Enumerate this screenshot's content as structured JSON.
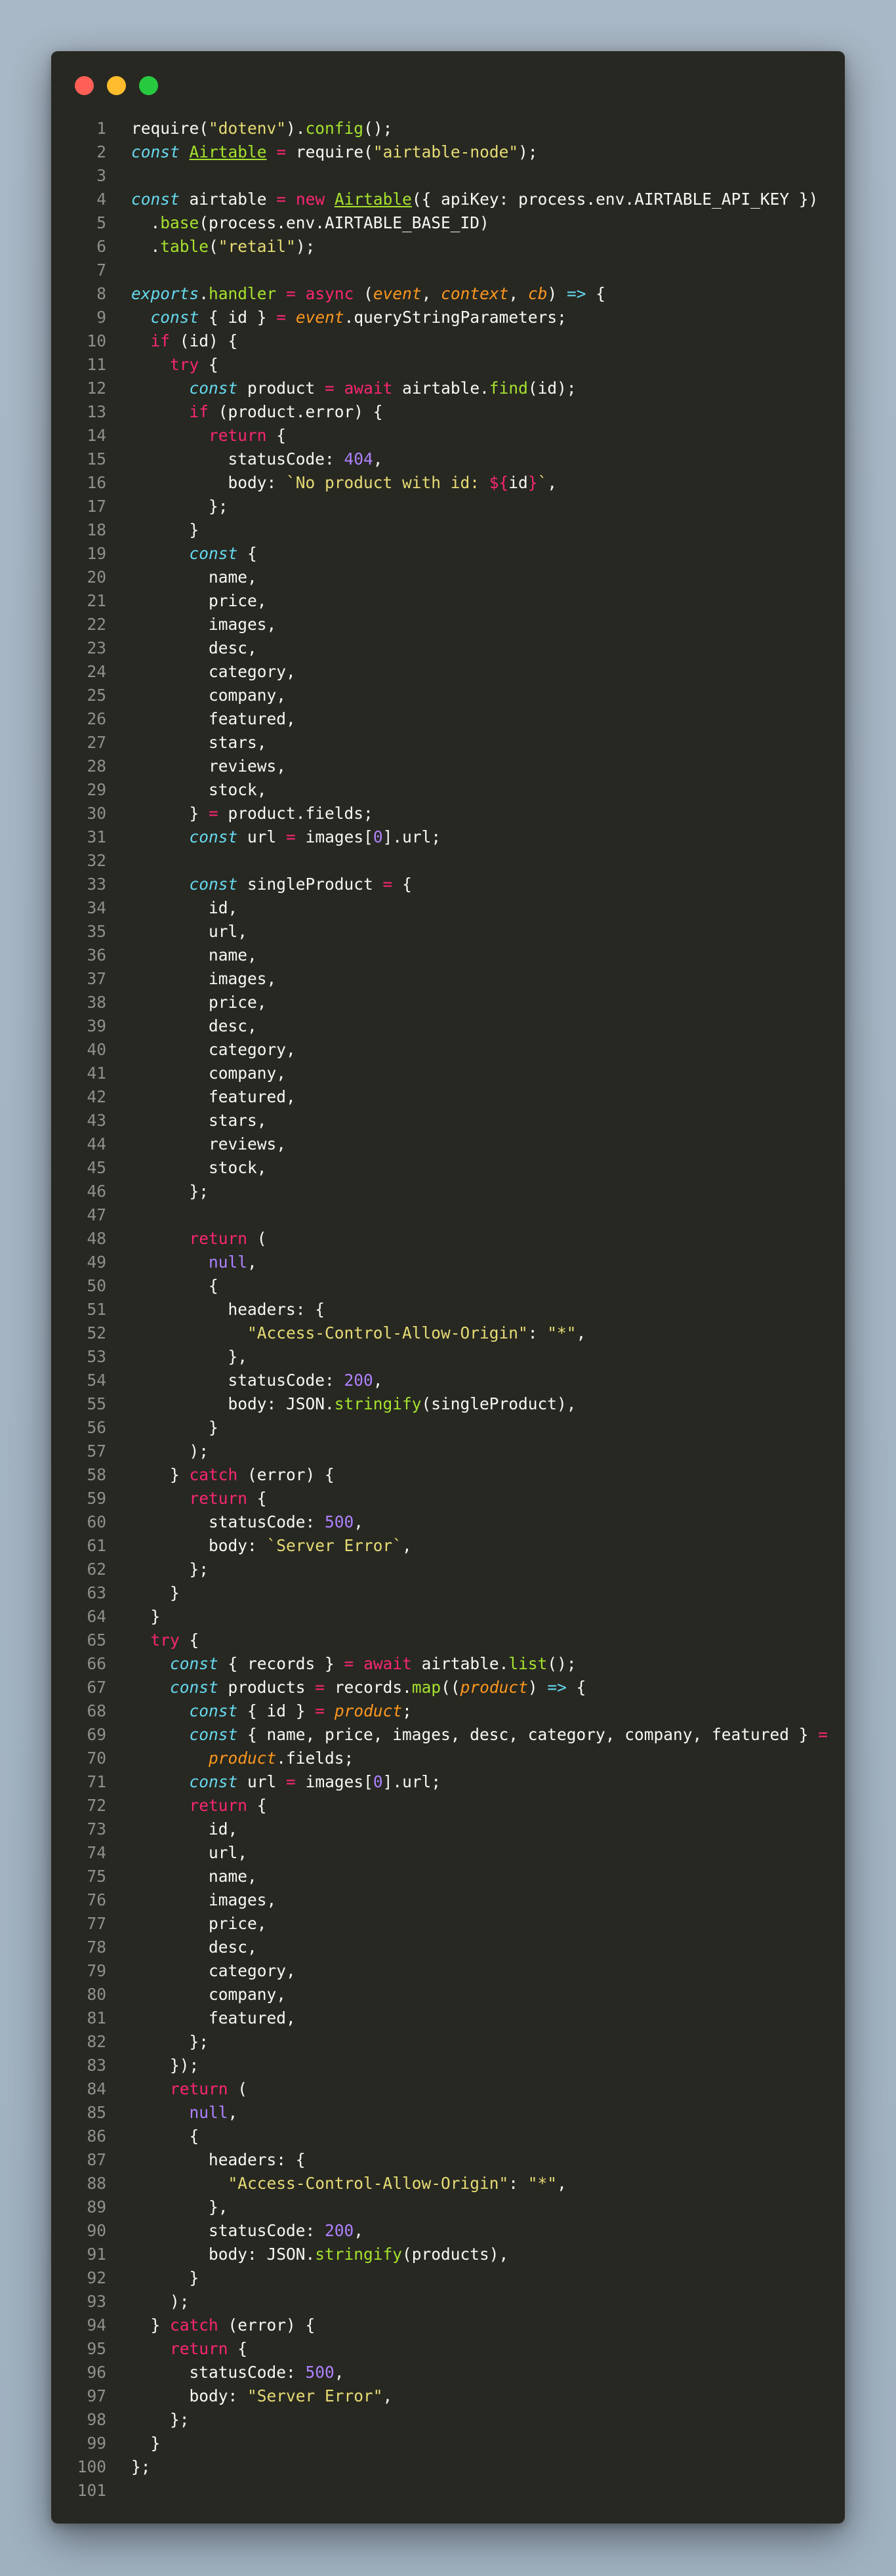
{
  "window": {
    "controls": [
      {
        "name": "close",
        "color": "#ff5f56"
      },
      {
        "name": "minimize",
        "color": "#ffbd2e"
      },
      {
        "name": "maximize",
        "color": "#27c93f"
      }
    ]
  },
  "code_lines": [
    "require(\"dotenv\").config();",
    "const Airtable = require(\"airtable-node\");",
    "",
    "const airtable = new Airtable({ apiKey: process.env.AIRTABLE_API_KEY })",
    "  .base(process.env.AIRTABLE_BASE_ID)",
    "  .table(\"retail\");",
    "",
    "exports.handler = async (event, context, cb) => {",
    "  const { id } = event.queryStringParameters;",
    "  if (id) {",
    "    try {",
    "      const product = await airtable.find(id);",
    "      if (product.error) {",
    "        return {",
    "          statusCode: 404,",
    "          body: `No product with id: ${id}`,",
    "        };",
    "      }",
    "      const {",
    "        name,",
    "        price,",
    "        images,",
    "        desc,",
    "        category,",
    "        company,",
    "        featured,",
    "        stars,",
    "        reviews,",
    "        stock,",
    "      } = product.fields;",
    "      const url = images[0].url;",
    "",
    "      const singleProduct = {",
    "        id,",
    "        url,",
    "        name,",
    "        images,",
    "        price,",
    "        desc,",
    "        category,",
    "        company,",
    "        featured,",
    "        stars,",
    "        reviews,",
    "        stock,",
    "      };",
    "",
    "      return (",
    "        null,",
    "        {",
    "          headers: {",
    "            \"Access-Control-Allow-Origin\": \"*\",",
    "          },",
    "          statusCode: 200,",
    "          body: JSON.stringify(singleProduct),",
    "        }",
    "      );",
    "    } catch (error) {",
    "      return {",
    "        statusCode: 500,",
    "        body: `Server Error`,",
    "      };",
    "    }",
    "  }",
    "  try {",
    "    const { records } = await airtable.list();",
    "    const products = records.map((product) => {",
    "      const { id } = product;",
    "      const { name, price, images, desc, category, company, featured } =",
    "        product.fields;",
    "      const url = images[0].url;",
    "      return {",
    "        id,",
    "        url,",
    "        name,",
    "        images,",
    "        price,",
    "        desc,",
    "        category,",
    "        company,",
    "        featured,",
    "      };",
    "    });",
    "    return (",
    "      null,",
    "      {",
    "        headers: {",
    "          \"Access-Control-Allow-Origin\": \"*\",",
    "        },",
    "        statusCode: 200,",
    "        body: JSON.stringify(products),",
    "      }",
    "    );",
    "  } catch (error) {",
    "    return {",
    "      statusCode: 500,",
    "      body: \"Server Error\",",
    "    };",
    "  }",
    "};",
    ""
  ]
}
